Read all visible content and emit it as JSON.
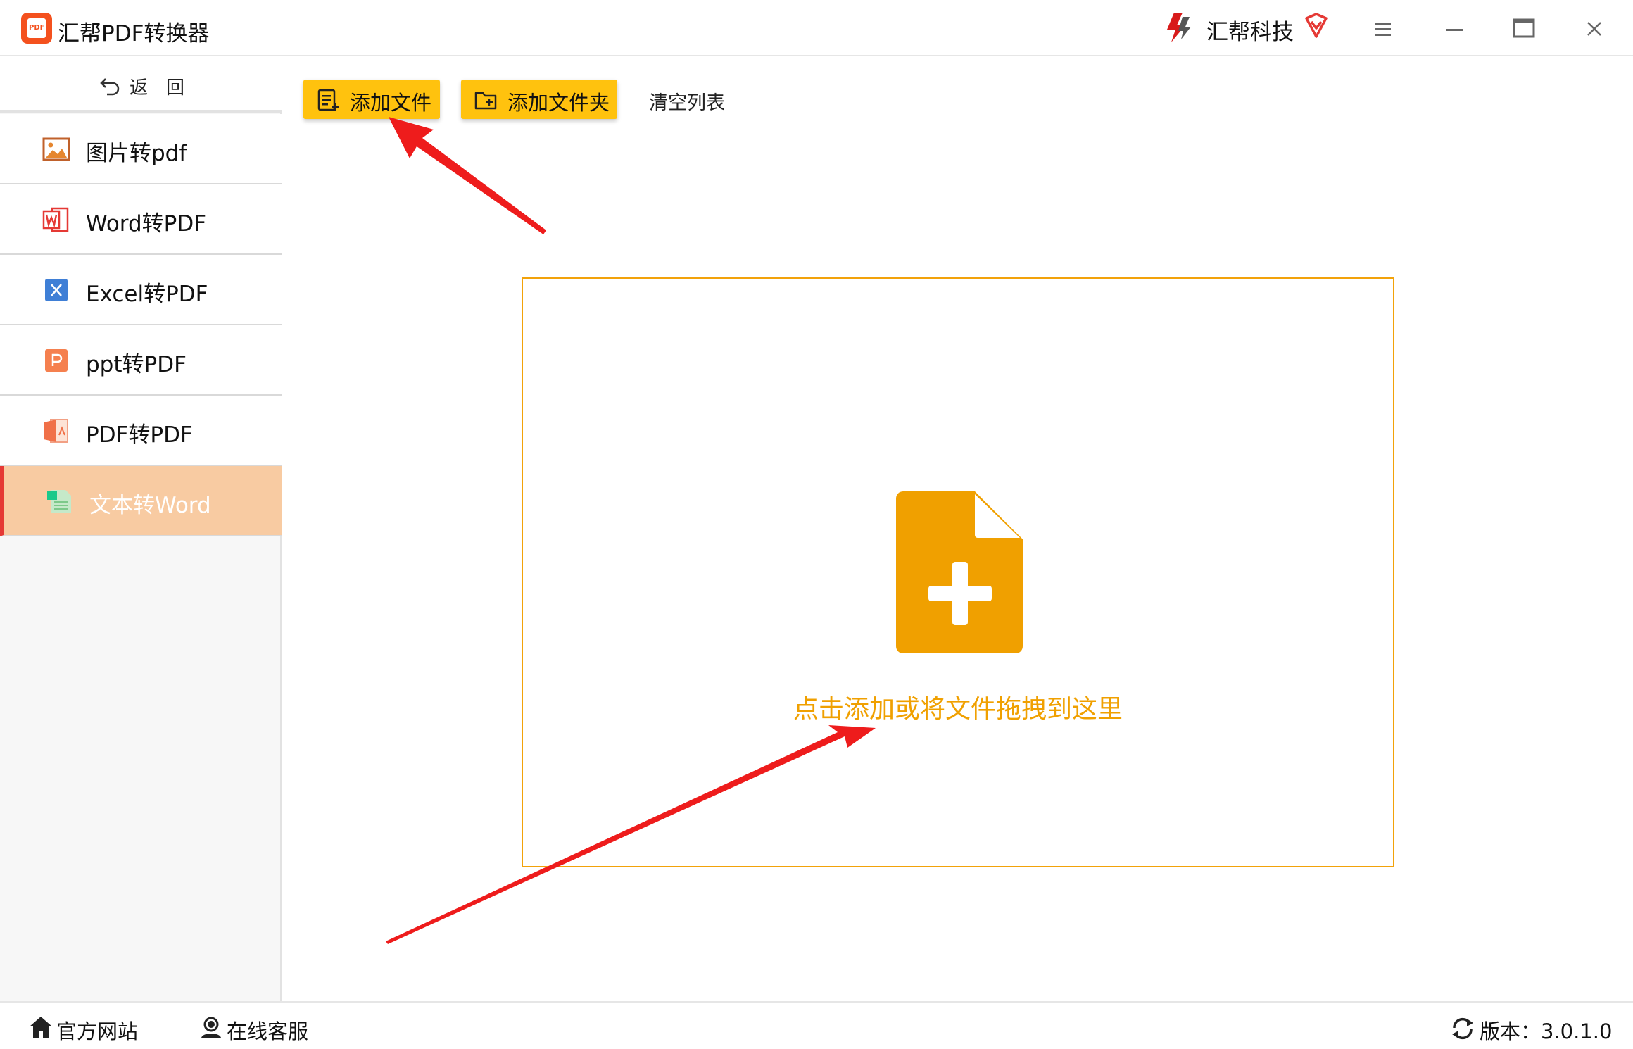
{
  "window": {
    "title": "汇帮PDF转换器",
    "brand": "汇帮科技"
  },
  "colors": {
    "accent": "#ffc20e",
    "dropzone_border": "#f2a20a",
    "dropzone_text": "#f0a000",
    "active_item_bg": "#f8cba2",
    "active_item_marker": "#e53935",
    "annotation_arrow": "#ee1c1c"
  },
  "sidebar": {
    "back_label": "返回",
    "items": [
      {
        "label": "图片转pdf",
        "icon": "image-icon"
      },
      {
        "label": "Word转PDF",
        "icon": "word-icon"
      },
      {
        "label": "Excel转PDF",
        "icon": "excel-icon"
      },
      {
        "label": "ppt转PDF",
        "icon": "ppt-icon"
      },
      {
        "label": "PDF转PDF",
        "icon": "pdf-icon"
      },
      {
        "label": "文本转Word",
        "icon": "text-file-icon",
        "active": true
      }
    ]
  },
  "toolbar": {
    "add_file": "添加文件",
    "add_folder": "添加文件夹",
    "clear_list": "清空列表"
  },
  "dropzone": {
    "hint": "点击添加或将文件拖拽到这里",
    "icon": "file-add-icon"
  },
  "footer": {
    "website": "官方网站",
    "support": "在线客服",
    "version": "版本：3.0.1.0"
  }
}
